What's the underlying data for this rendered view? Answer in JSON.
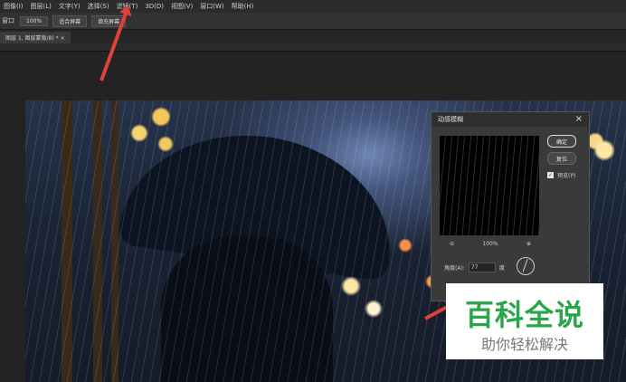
{
  "menubar": {
    "items": [
      "图像(I)",
      "图层(L)",
      "文字(Y)",
      "选择(S)",
      "滤镜(T)",
      "3D(D)",
      "视图(V)",
      "窗口(W)",
      "帮助(H)"
    ]
  },
  "options_bar": {
    "label": "窗口",
    "buttons": [
      "100%",
      "适合屏幕",
      "填充屏幕"
    ]
  },
  "document_tab": {
    "title": "图层 1, 图层蒙版/8) *",
    "close": "×"
  },
  "dialog": {
    "title": "动感模糊",
    "close": "×",
    "ok_label": "确定",
    "reset_label": "复位",
    "preview_label": "预览(P)",
    "preview_checked": true,
    "zoom_out": "⊖",
    "zoom_level": "100%",
    "zoom_in": "⊕",
    "angle_label": "角度(A):",
    "angle_value": "77",
    "angle_unit": "度"
  },
  "watermark": {
    "title": "百科全说",
    "subtitle": "助你轻松解决"
  },
  "colors": {
    "arrow": "#e0413a",
    "watermark_green": "#27a64a"
  }
}
